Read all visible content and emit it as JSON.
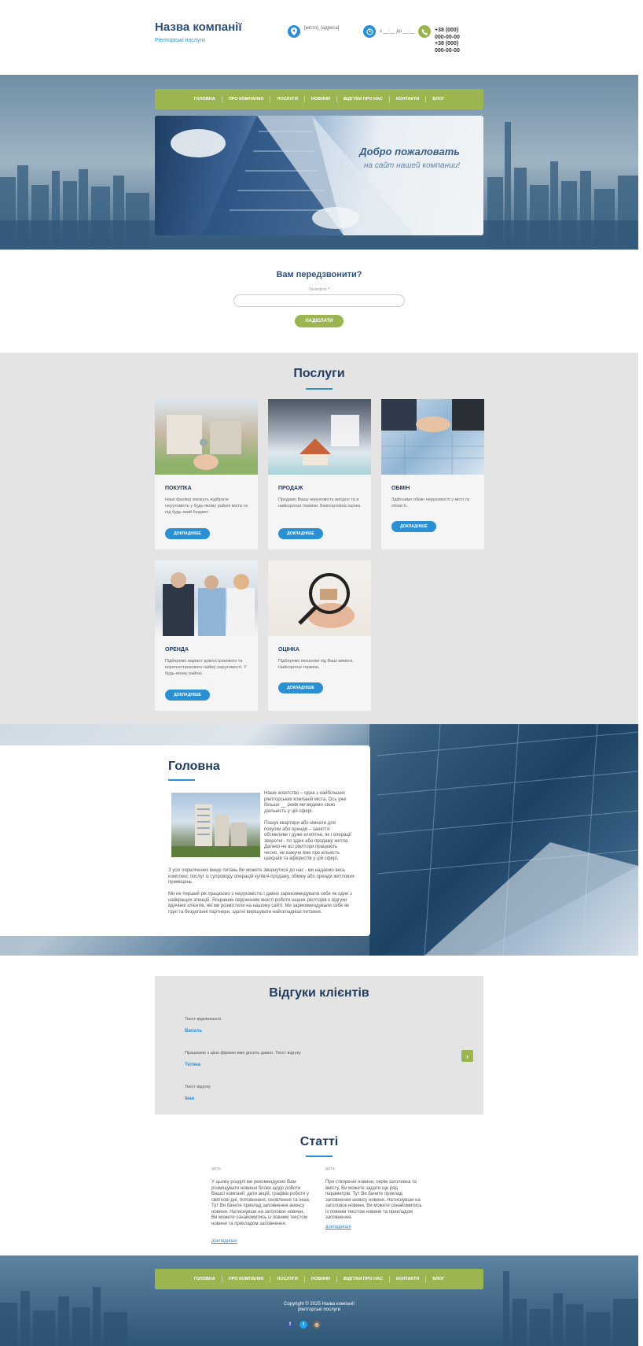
{
  "header": {
    "company_name": "Назва компанії",
    "tagline": "Ріелторські послуги",
    "address": "[місто], [адреса]",
    "hours": "з __:__ до __:__",
    "phone1": "+38 (000)",
    "phone1b": "000-00-00",
    "phone2": "+38 (000)",
    "phone2b": "000-00-00",
    "icons": [
      "location-pin-icon",
      "clock-icon",
      "phone-icon"
    ]
  },
  "nav": {
    "items": [
      "ГОЛОВНА",
      "ПРО КОМПАНІЮ",
      "ПОСЛУГИ",
      "НОВИНИ",
      "ВІДГУКИ ПРО НАС",
      "КОНТАКТИ",
      "БЛОГ"
    ]
  },
  "banner": {
    "title": "Добро пожаловать",
    "subtitle": "на сайт нашей компании!"
  },
  "callback": {
    "title": "Вам передзвонити?",
    "label": "Телефон",
    "required_mark": "*",
    "button": "НАДІСЛАТИ"
  },
  "services": {
    "title": "Послуги",
    "items": [
      {
        "title": "ПОКУПКА",
        "text": "Наші фахівці зможуть підібрати нерухомість у будь-якому районі міста та під будь-який бюджет.",
        "button": "ДОКЛАДНІШЕ"
      },
      {
        "title": "ПРОДАЖ",
        "text": "Продамо Вашу нерухомість вигідно та в найкоротші терміни. Безкоштовна оцінка.",
        "button": "ДОКЛАДНІШЕ"
      },
      {
        "title": "ОБМІН",
        "text": "Здійснимо обмін нерухомості у місті та області.",
        "button": "ДОКЛАДНІШЕ"
      },
      {
        "title": "ОРЕНДА",
        "text": "Підберемо варіант довгострокового та короткострокового найму нерухомості. У будь-якому районі.",
        "button": "ДОКЛАДНІШЕ"
      },
      {
        "title": "ОЦІНКА",
        "text": "Підберемо механізм під Ваші вимоги. Найкоротші терміни.",
        "button": "ДОКЛАДНІШЕ"
      }
    ]
  },
  "about": {
    "title": "Головна",
    "p1": "Наше агентство – одна з найбільших ріелторських компаній міста. Ось уже більше __ років ми ведемо свою діяльність у цій сфері.",
    "p2": "Пошук квартири або кімнати для покупки або оренди – заняття обтяжливе і дуже клопітне, як і операції зворотні - по здачі або продажу житла. Далеко не всі ріелтори працюють чесно, не кажучи вже про кількість шахраїв та аферистів у цій сфері.",
    "p3": "З усіх перелічених вище питань Ви можете звернутися до нас - ми надаємо весь комплекс послуг із супроводу операцій купівлі-продажу, обміну або оренди житлових приміщень.",
    "p4": "Ми не перший рік працюємо з нерухомістю і давно зарекомендували себе як одне з найкращих агенцій. Яскравим свідченням якості роботи наших ріелторів є відгуки вдячних клієнтів, які ми розмістили на нашому сайті. Ми зарекомендували себе як гідні та бездоганні партнери, здатні вирішувати найскладніші питання."
  },
  "reviews": {
    "title": "Відгуки клієнтів",
    "items": [
      {
        "text": "Текст відкликання.",
        "name": "Василь"
      },
      {
        "text": "Працюємо з цією фірмою вже досить давно. Текст відгуку",
        "name": "Тетяна"
      },
      {
        "text": "Текст відгуку",
        "name": "Іван"
      }
    ],
    "next_icon": "chevron-right-icon"
  },
  "articles": {
    "title": "Статті",
    "items": [
      {
        "date": "дата",
        "text": "У цьому розділі ми рекомендуємо Вам розміщувати новинні блоки щодо роботи Вашої компанії: дати акцій, графіки роботи у святкові дні, поповнення, оновлення та інше. Тут Ви бачите приклад заповнення анонсу новини. Натиснувши на заголовок новини, Ви можете ознайомитись із повним текстом новини та прикладом заповнення.",
        "more": "докладніше"
      },
      {
        "date": "дата",
        "text": "При створенні новини, окрім заголовка та вмісту, Ви можете задати ще ряд параметрів. Тут Ви бачите приклад заповнення анонсу новини. Натиснувши на заголовок новини, Ви можете ознайомитись із повним текстом новини та прикладом заповнення.",
        "more": "докладніше"
      }
    ]
  },
  "footer": {
    "copyright1": "Copyright © 2025 Назва компанії",
    "copyright2": "ріелторські послуги",
    "social": [
      "facebook-icon",
      "twitter-icon",
      "instagram-icon"
    ]
  },
  "colors": {
    "accent_green": "#9bb551",
    "accent_blue": "#2b8fd4",
    "heading_navy": "#1f3b5e"
  }
}
